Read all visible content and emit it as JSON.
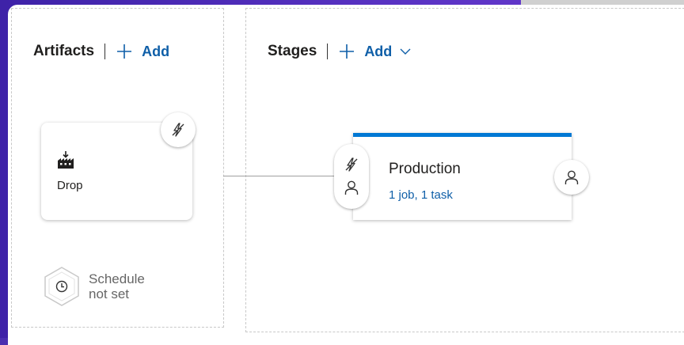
{
  "artifacts": {
    "title": "Artifacts",
    "add_label": "Add",
    "items": [
      {
        "name": "Drop",
        "icon": "build-artifact-icon"
      }
    ],
    "schedule": {
      "line1": "Schedule",
      "line2": "not set"
    }
  },
  "stages": {
    "title": "Stages",
    "add_label": "Add",
    "items": [
      {
        "name": "Production",
        "summary": "1 job, 1 task"
      }
    ]
  },
  "colors": {
    "accent": "#0078d4",
    "link": "#0f5fa8",
    "background": "#4a2fb0"
  }
}
